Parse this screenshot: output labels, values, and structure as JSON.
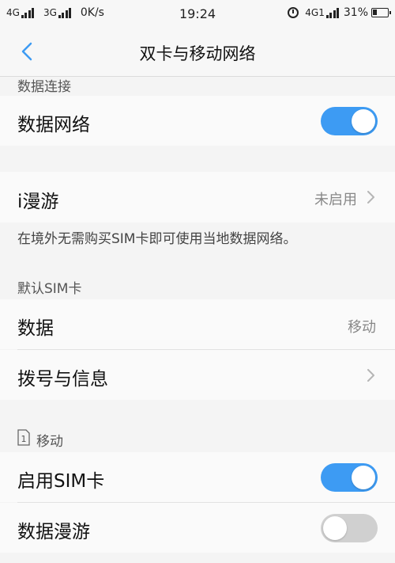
{
  "status_bar": {
    "network_left": "4G",
    "network_mid": "3G",
    "speed": "0K/s",
    "time": "19:24",
    "network_right": "4G1",
    "battery": "31%"
  },
  "header": {
    "title": "双卡与移动网络"
  },
  "sections": {
    "data_connection_label": "数据连接",
    "data_network": {
      "label": "数据网络",
      "enabled": true
    },
    "roaming": {
      "label": "i漫游",
      "value": "未启用"
    },
    "roaming_note": "在境外无需购买SIM卡即可使用当地数据网络。",
    "default_sim_label": "默认SIM卡",
    "data_row": {
      "label": "数据",
      "value": "移动"
    },
    "dial_row": {
      "label": "拨号与信息"
    },
    "sim1_label": "移动",
    "sim1_number": "1",
    "enable_sim": {
      "label": "启用SIM卡",
      "enabled": true
    },
    "data_roaming": {
      "label": "数据漫游",
      "enabled": false
    }
  },
  "colors": {
    "toggle_on": "#3d9bf3",
    "toggle_off": "#d0d0d0",
    "accent": "#3d9bf3"
  }
}
